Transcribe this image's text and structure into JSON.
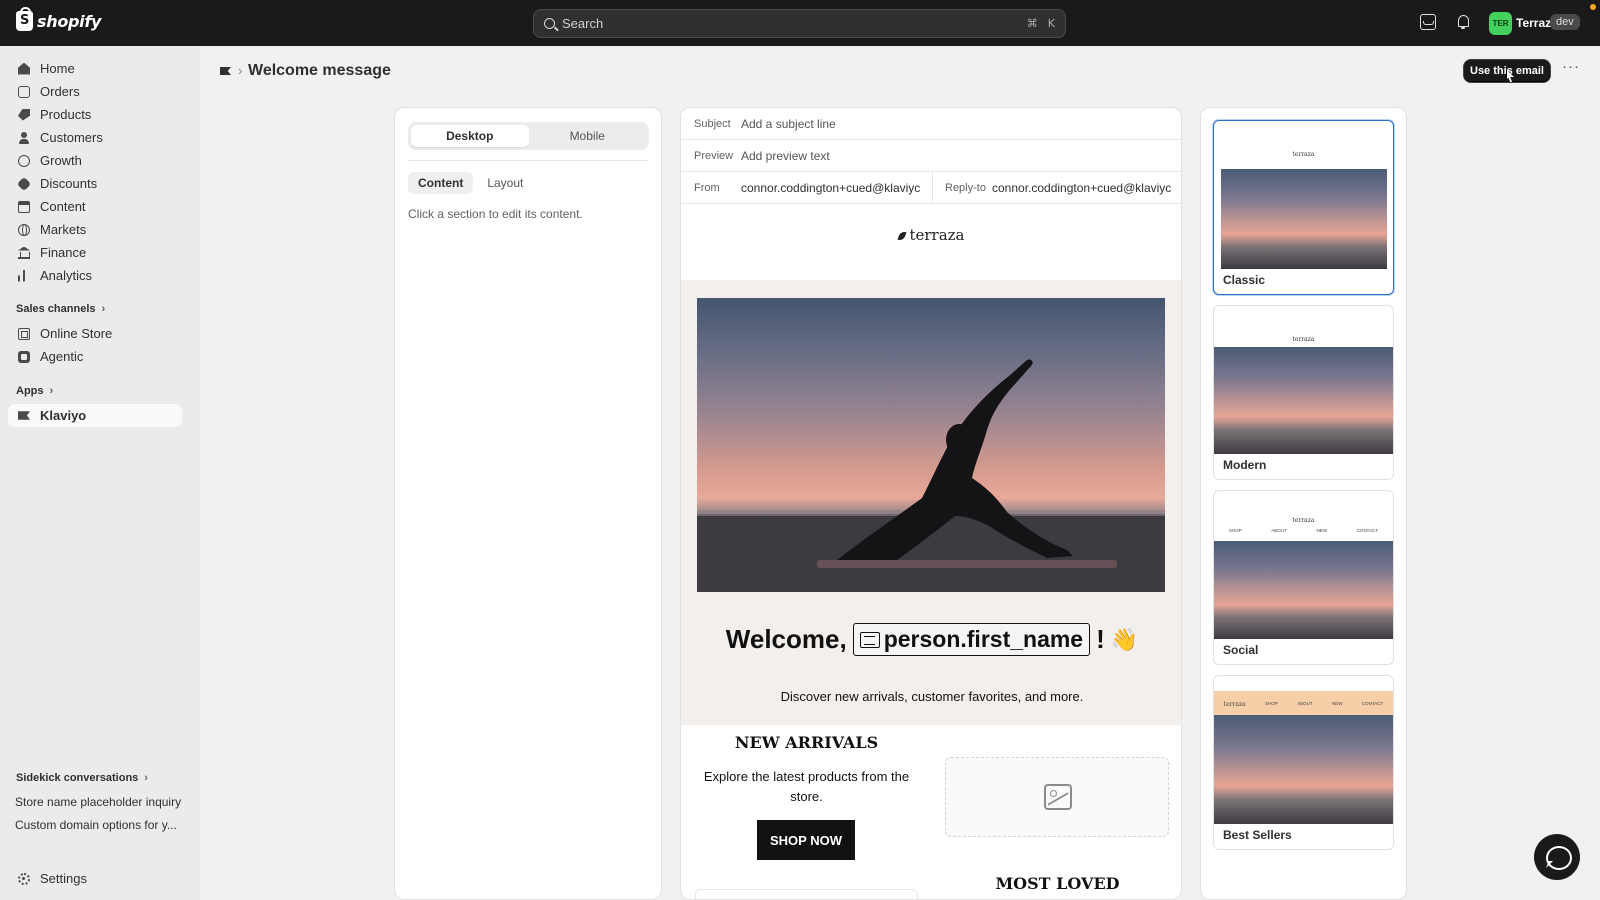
{
  "topbar": {
    "logo_text": "shopify",
    "search_placeholder": "Search",
    "shortcut_cmd": "⌘",
    "shortcut_key": "K",
    "store_initials": "TER",
    "store_name": "Terraza",
    "store_badge": "dev"
  },
  "sidebar": {
    "items": [
      {
        "label": "Home",
        "icon": "home-icon"
      },
      {
        "label": "Orders",
        "icon": "orders-icon"
      },
      {
        "label": "Products",
        "icon": "products-icon"
      },
      {
        "label": "Customers",
        "icon": "customers-icon"
      },
      {
        "label": "Growth",
        "icon": "growth-icon"
      },
      {
        "label": "Discounts",
        "icon": "discounts-icon"
      },
      {
        "label": "Content",
        "icon": "content-icon"
      },
      {
        "label": "Markets",
        "icon": "markets-icon"
      },
      {
        "label": "Finance",
        "icon": "finance-icon"
      },
      {
        "label": "Analytics",
        "icon": "analytics-icon"
      }
    ],
    "sales_channels_title": "Sales channels",
    "channels": [
      {
        "label": "Online Store",
        "icon": "online-store-icon"
      },
      {
        "label": "Agentic",
        "icon": "agentic-icon"
      }
    ],
    "apps_title": "Apps",
    "apps": [
      {
        "label": "Klaviyo",
        "icon": "klaviyo-icon",
        "active": true
      }
    ],
    "sidekick_title": "Sidekick conversations",
    "conversations": [
      "Store name placeholder inquiry",
      "Custom domain options for y..."
    ],
    "settings_label": "Settings"
  },
  "header": {
    "title": "Welcome message",
    "primary_button": "Use this email",
    "more_label": "···"
  },
  "editor": {
    "view_toggle": [
      "Desktop",
      "Mobile"
    ],
    "active_view": "Desktop",
    "tabs": [
      "Content",
      "Layout"
    ],
    "active_tab": "Content",
    "hint": "Click a section to edit its content."
  },
  "email": {
    "subject_label": "Subject",
    "subject_placeholder": "Add a subject line",
    "preview_label": "Preview",
    "preview_placeholder": "Add preview text",
    "from_label": "From",
    "from_value": "connor.coddington+cued@klaviyc",
    "replyto_label": "Reply-to",
    "replyto_value": "connor.coddington+cued@klaviyc",
    "brand": "terraza",
    "welcome_text": "Welcome,",
    "personalization_tag": "person.first_name",
    "exclaim": "!",
    "wave_emoji": "👋",
    "discover_text": "Discover new arrivals, customer favorites, and more.",
    "new_arrivals_heading": "NEW ARRIVALS",
    "new_arrivals_body": "Explore the latest products from the store.",
    "shop_button": "SHOP NOW",
    "most_loved_heading": "MOST LOVED"
  },
  "templates": [
    {
      "name": "Classic",
      "selected": true
    },
    {
      "name": "Modern",
      "selected": false
    },
    {
      "name": "Social",
      "selected": false,
      "nav": [
        "SHOP",
        "ABOUT",
        "NEW",
        "CONTACT"
      ]
    },
    {
      "name": "Best Sellers",
      "selected": false,
      "nav": [
        "SHOP",
        "ABOUT",
        "NEW",
        "CONTACT"
      ]
    }
  ],
  "template_brand": "terraza",
  "colors": {
    "topbar": "#1a1a1a",
    "accent_selected": "#2c6ecb",
    "store_avatar": "#44d05c",
    "bestsellers_header": "#f6cfa8"
  }
}
